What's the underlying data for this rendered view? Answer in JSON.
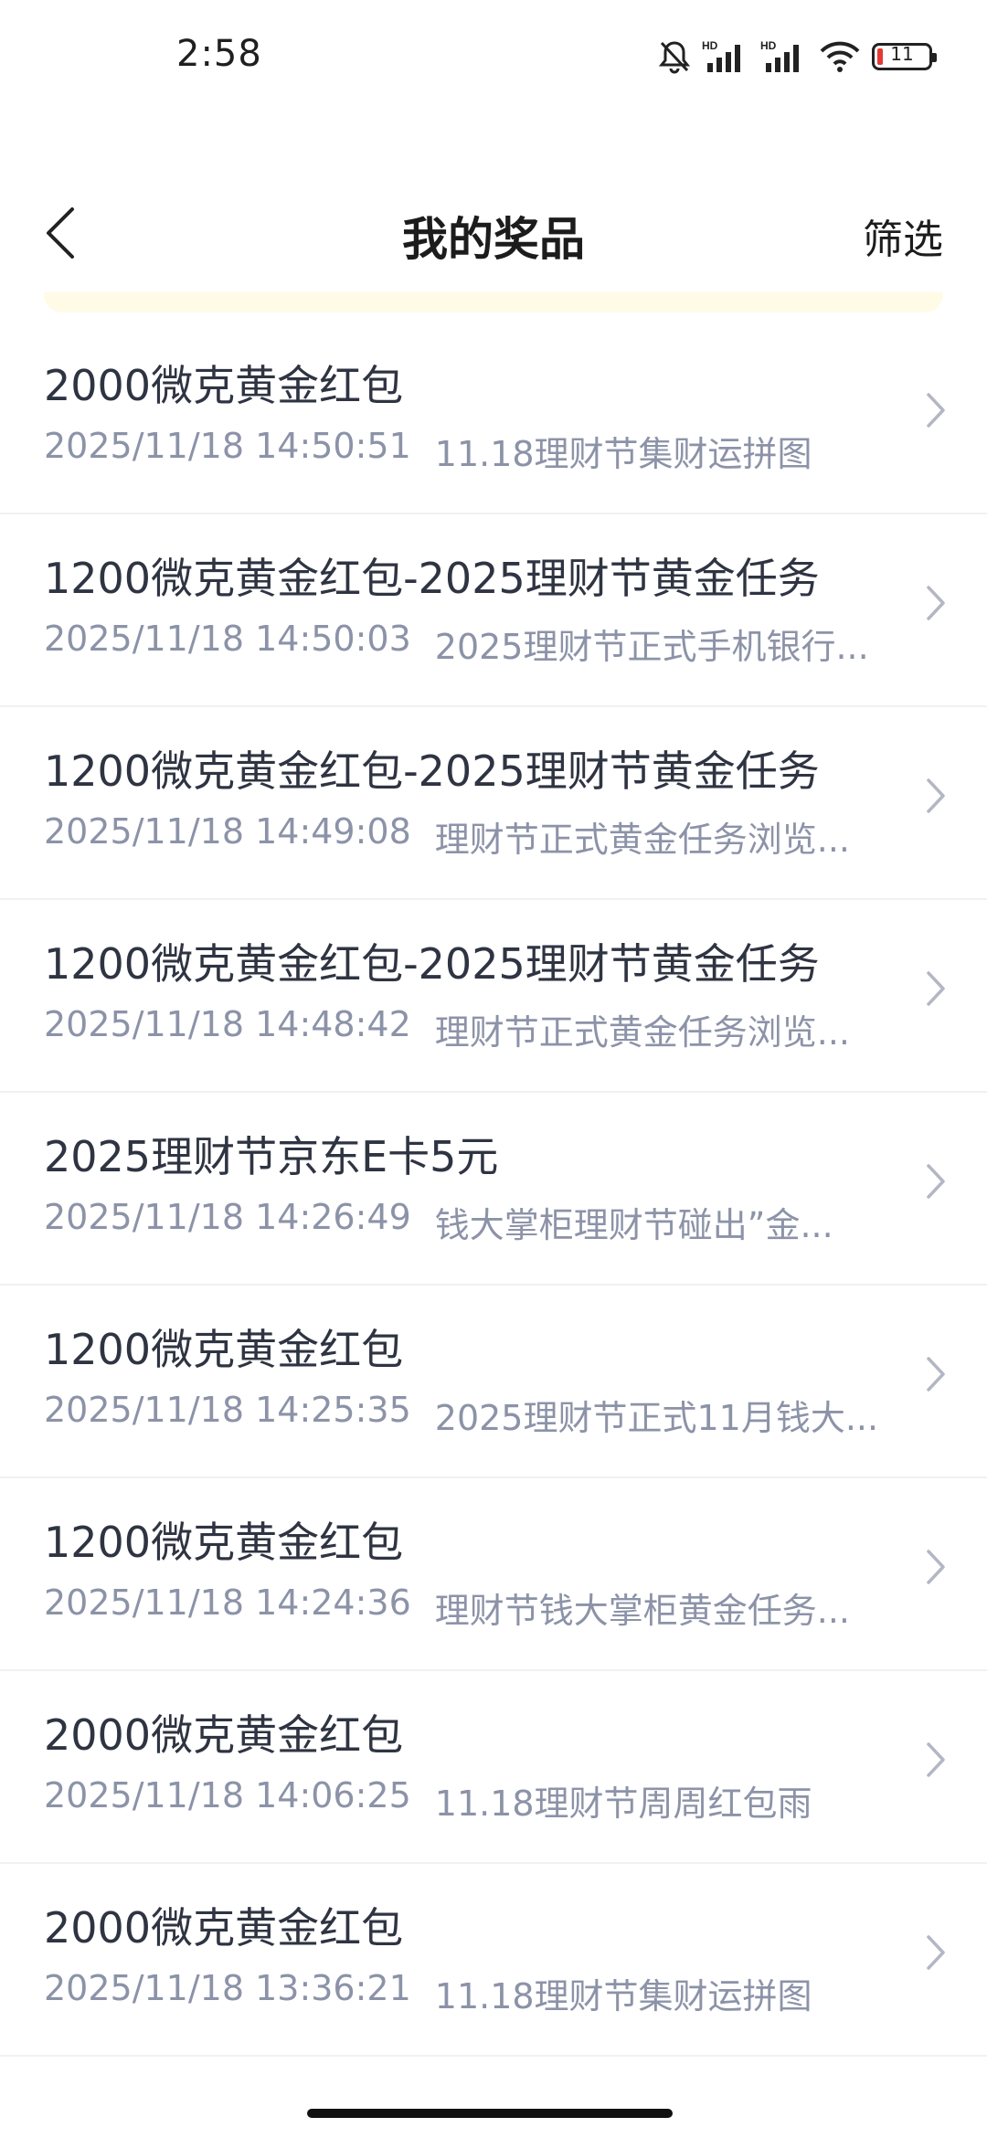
{
  "status_bar": {
    "time": "2:58",
    "battery_level": "11",
    "icons": [
      "mute-bell-icon",
      "hd-signal-icon",
      "hd-signal-icon",
      "wifi-icon",
      "battery-icon"
    ]
  },
  "nav": {
    "title": "我的奖品",
    "filter_label": "筛选",
    "back_icon": "chevron-left-icon"
  },
  "colors": {
    "notice_strip": "#fffbe6",
    "title_text": "#2f3442",
    "sub_text": "#8c93a8",
    "battery_low": "#e53935"
  },
  "prizes": [
    {
      "title": "2000微克黄金红包",
      "time": "2025/11/18 14:50:51",
      "desc": "11.18理财节集财运拼图"
    },
    {
      "title": "1200微克黄金红包-2025理财节黄金任务",
      "time": "2025/11/18 14:50:03",
      "desc": "2025理财节正式手机银行..."
    },
    {
      "title": "1200微克黄金红包-2025理财节黄金任务",
      "time": "2025/11/18 14:49:08",
      "desc": "理财节正式黄金任务浏览..."
    },
    {
      "title": "1200微克黄金红包-2025理财节黄金任务",
      "time": "2025/11/18 14:48:42",
      "desc": "理财节正式黄金任务浏览..."
    },
    {
      "title": "2025理财节京东E卡5元",
      "time": "2025/11/18 14:26:49",
      "desc": "钱大掌柜理财节碰出”金..."
    },
    {
      "title": "1200微克黄金红包",
      "time": "2025/11/18 14:25:35",
      "desc": "2025理财节正式11月钱大..."
    },
    {
      "title": "1200微克黄金红包",
      "time": "2025/11/18 14:24:36",
      "desc": "理财节钱大掌柜黄金任务..."
    },
    {
      "title": "2000微克黄金红包",
      "time": "2025/11/18 14:06:25",
      "desc": "11.18理财节周周红包雨"
    },
    {
      "title": "2000微克黄金红包",
      "time": "2025/11/18 13:36:21",
      "desc": "11.18理财节集财运拼图"
    }
  ]
}
